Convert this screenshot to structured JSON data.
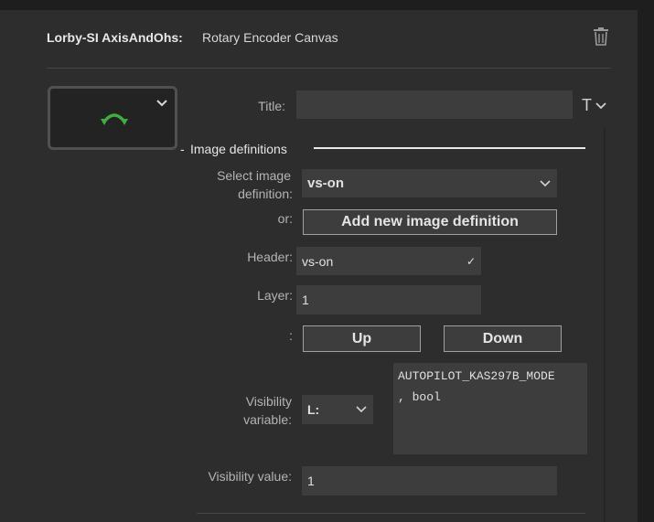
{
  "header": {
    "plugin_name": "Lorby-SI AxisAndOhs:",
    "action_name": "Rotary Encoder Canvas"
  },
  "form": {
    "title_label": "Title:",
    "title_value": "",
    "title_type_glyph": "T"
  },
  "section": {
    "dash": "-",
    "title": "Image definitions"
  },
  "image_def": {
    "select_label_line1": "Select image",
    "select_label_line2": "definition:",
    "select_value": "vs-on",
    "or_label": "or:",
    "add_button": "Add new image definition",
    "header_label": "Header:",
    "header_value": "vs-on",
    "header_check": "✓",
    "layer_label": "Layer:",
    "layer_value": "1",
    "order_label": ":",
    "up_button": "Up",
    "down_button": "Down",
    "visibility_var_label_line1": "Visibility",
    "visibility_var_label_line2": "variable:",
    "var_type_value": "L:",
    "var_name_value": "AUTOPILOT_KAS297B_MODE\n, bool",
    "visibility_value_label": "Visibility value:",
    "visibility_value": "1"
  },
  "colors": {
    "background": "#2d2d2d",
    "field": "#3d3d3d",
    "icon_green": "#3fae3f"
  }
}
